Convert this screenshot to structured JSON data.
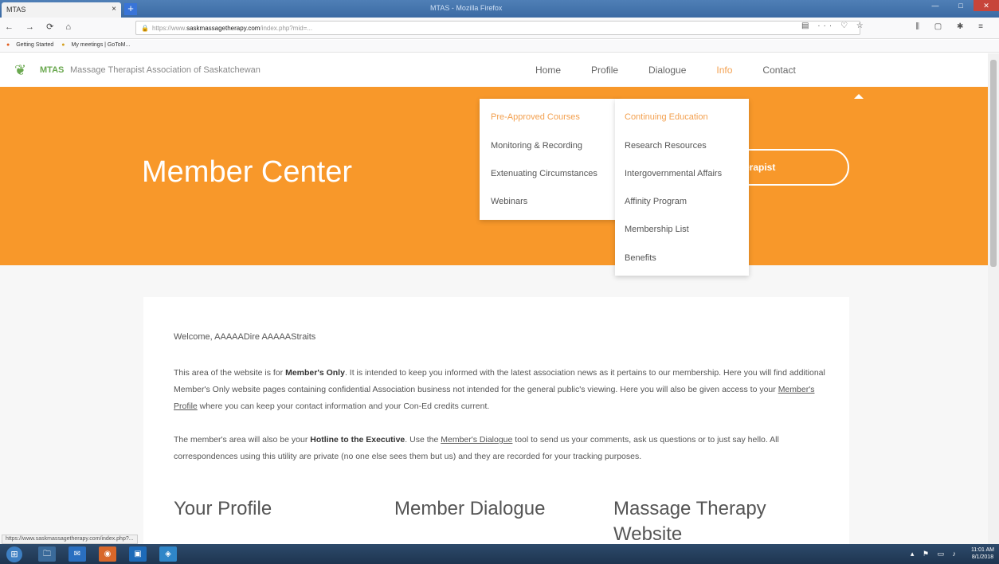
{
  "browser": {
    "tab_title": "MTAS",
    "tab_close": "×",
    "newtab": "+",
    "window_title": "MTAS - Mozilla Firefox",
    "win_min": "—",
    "win_max": "□",
    "win_close": "✕",
    "nav_buttons": "← → ⟳ ⌂",
    "url_lock": "🔒",
    "url_prefix": "https://www.",
    "url_domain": "saskmassagetherapy.com",
    "url_rest": "/index.php?mid=...",
    "url_actions": "▤ ··· ♡ ☆",
    "tool_icons": "⫼ ▢ ✱ ≡",
    "bookmarks": [
      "Getting Started",
      "My meetings | GoToM..."
    ],
    "status_url": "https://www.saskmassagetherapy.com/index.php?..."
  },
  "site": {
    "logo_glyph": "❦",
    "brand_short": "MTAS",
    "brand_name": "Massage Therapist Association of Saskatchewan",
    "nav": [
      "Home",
      "Profile",
      "Dialogue",
      "Info",
      "Contact"
    ],
    "active_nav": "Info"
  },
  "hero": {
    "title": "Member Center",
    "button_label": "erapist"
  },
  "dropdown": {
    "col1": [
      "Pre-Approved Courses",
      "Monitoring & Recording",
      "Extenuating Circumstances",
      "Webinars"
    ],
    "col2": [
      "Continuing Education",
      "Research Resources",
      "Intergovernmental Affairs",
      "Affinity Program",
      "Membership List",
      "Benefits"
    ],
    "highlighted": [
      "Pre-Approved Courses",
      "Continuing Education"
    ]
  },
  "content": {
    "welcome": "Welcome, AAAAADire AAAAAStraits",
    "p1_a": "This area of the website is for ",
    "p1_b": "Member's Only",
    "p1_c": ". It is intended to keep you informed with the latest association news as it pertains to our membership. Here you will find additional Member's Only website pages containing confidential Association business not intended for the general public's viewing. Here you will also be given access to your ",
    "p1_link": "Member's Profile",
    "p1_d": " where you can keep your contact information and your Con-Ed credits current.",
    "p2_a": "The member's area will also be your ",
    "p2_b": "Hotline to the Executive",
    "p2_c": ". Use the ",
    "p2_link": "Member's Dialogue",
    "p2_d": " tool to send us your comments, ask us questions or to just say hello. All correspondences using this utility are private (no one else sees them but us) and they are recorded for your tracking purposes.",
    "sections": [
      "Your Profile",
      "Member Dialogue",
      "Massage Therapy Website"
    ]
  },
  "taskbar": {
    "start": "⊞",
    "apps": [
      "🗀",
      "✉",
      "◉",
      "▣",
      "◈"
    ],
    "tray": "▴ ⚑ ▭ ♪",
    "time": "11:01 AM",
    "date": "8/1/2018"
  },
  "colors": {
    "hero_orange": "#f8982a",
    "accent": "#f3a04f",
    "brand_green": "#6aa84f"
  }
}
